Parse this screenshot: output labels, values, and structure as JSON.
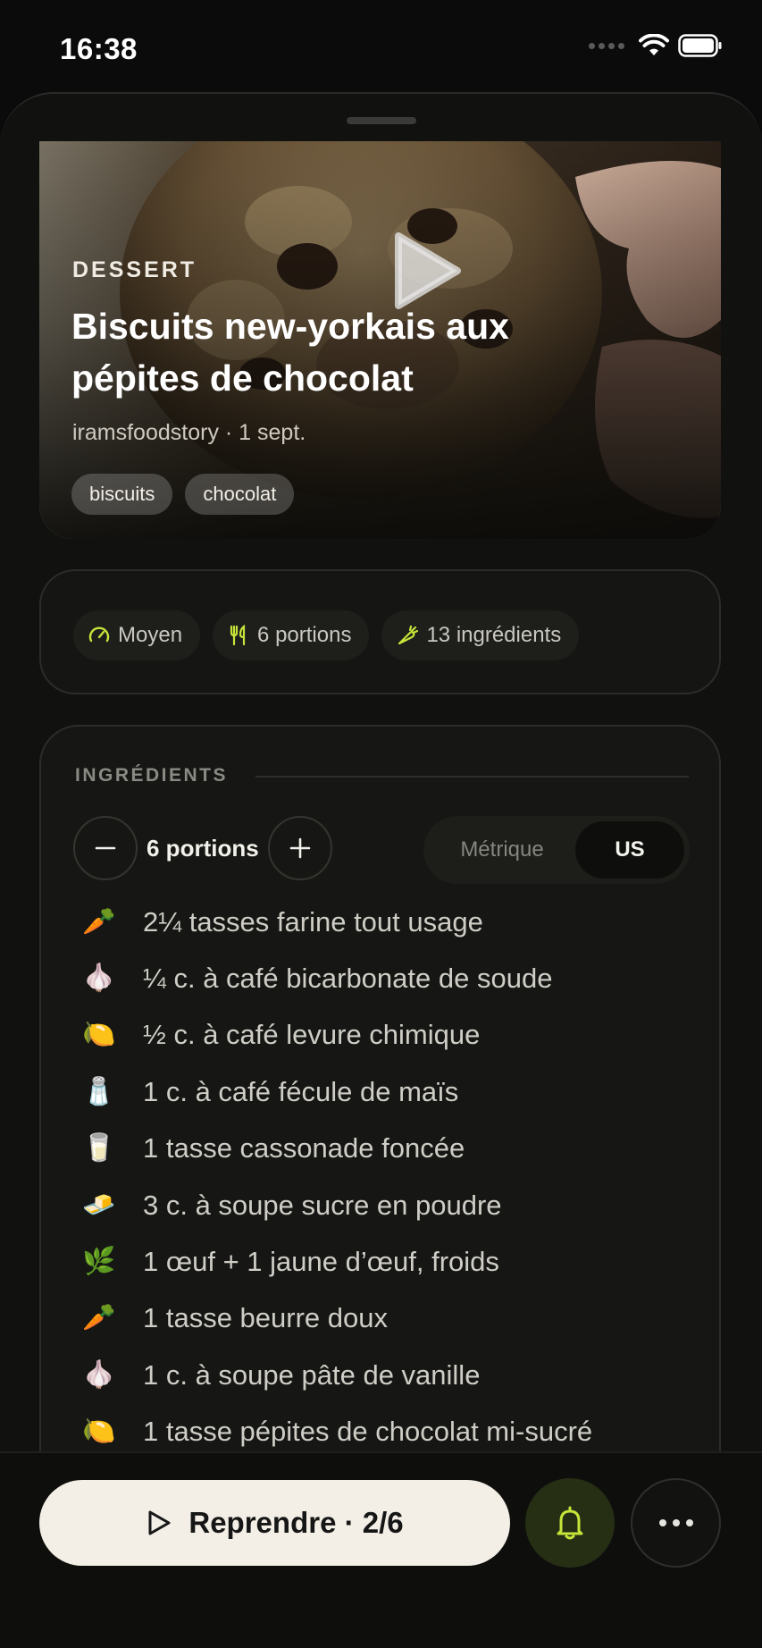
{
  "status_bar": {
    "time": "16:38"
  },
  "hero": {
    "category": "DESSERT",
    "title": "Biscuits new-yorkais aux pépites de chocolat",
    "meta": "iramsfoodstory · 1 sept.",
    "tags": [
      "biscuits",
      "chocolat"
    ]
  },
  "info": {
    "difficulty": "Moyen",
    "portions": "6 portions",
    "ingredients_count": "13 ingrédients"
  },
  "ingredients": {
    "heading": "INGRÉDIENTS",
    "portions_label": "6 portions",
    "units": {
      "metric": "Métrique",
      "us": "US",
      "selected": "US"
    },
    "items": [
      {
        "icon": "🥕",
        "text": "2¼ tasses farine tout usage"
      },
      {
        "icon": "🧄",
        "text": "¼ c. à café bicarbonate de soude"
      },
      {
        "icon": "🍋",
        "text": "½ c. à café levure chimique"
      },
      {
        "icon": "🧂",
        "text": "1 c. à café fécule de maïs"
      },
      {
        "icon": "🥛",
        "text": "1 tasse cassonade foncée"
      },
      {
        "icon": "🧈",
        "text": "3 c. à soupe sucre en poudre"
      },
      {
        "icon": "🌿",
        "text": "1 œuf + 1 jaune d’œuf, froids"
      },
      {
        "icon": "🥕",
        "text": "1 tasse beurre doux"
      },
      {
        "icon": "🧄",
        "text": "1 c. à soupe pâte de vanille"
      },
      {
        "icon": "🍋",
        "text": "1 tasse pépites de chocolat mi-sucré"
      }
    ]
  },
  "actions": {
    "resume_label": "Reprendre · 2/6"
  },
  "colors": {
    "accent": "#c6e53a",
    "background": "#0b0b0b",
    "card": "#161714",
    "primary_button": "#f3efe6"
  }
}
